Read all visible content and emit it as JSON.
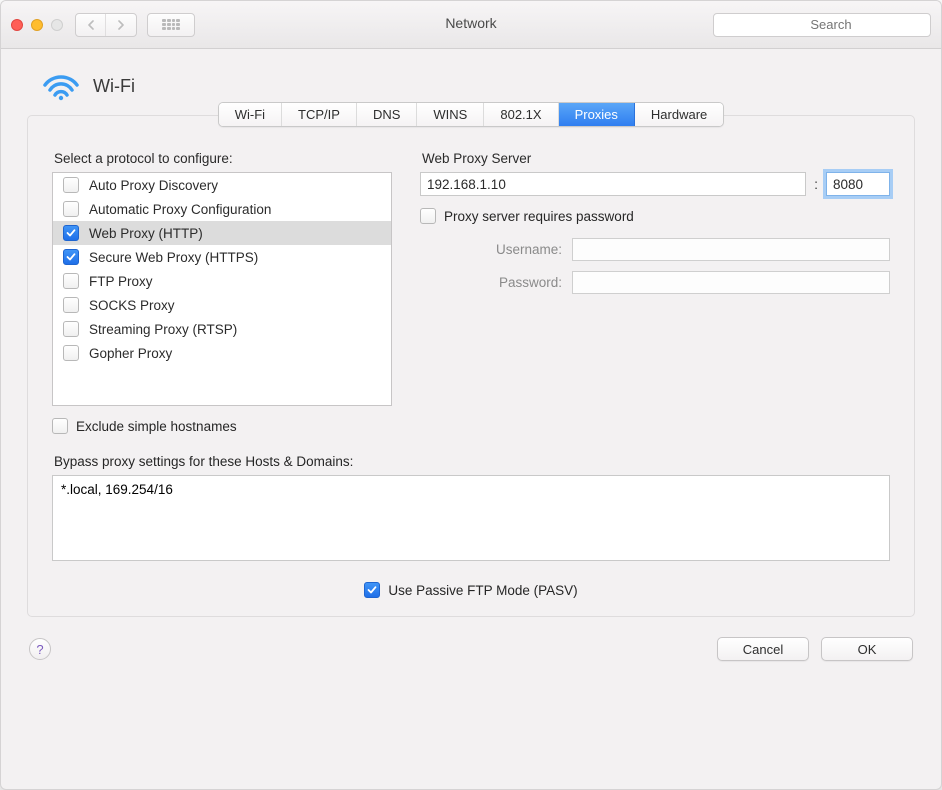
{
  "window": {
    "title": "Network",
    "search_placeholder": "Search"
  },
  "header": {
    "title": "Wi-Fi"
  },
  "tabs": [
    {
      "label": "Wi-Fi",
      "active": false
    },
    {
      "label": "TCP/IP",
      "active": false
    },
    {
      "label": "DNS",
      "active": false
    },
    {
      "label": "WINS",
      "active": false
    },
    {
      "label": "802.1X",
      "active": false
    },
    {
      "label": "Proxies",
      "active": true
    },
    {
      "label": "Hardware",
      "active": false
    }
  ],
  "protocols": {
    "section_label": "Select a protocol to configure:",
    "items": [
      {
        "label": "Auto Proxy Discovery",
        "checked": false,
        "selected": false
      },
      {
        "label": "Automatic Proxy Configuration",
        "checked": false,
        "selected": false
      },
      {
        "label": "Web Proxy (HTTP)",
        "checked": true,
        "selected": true
      },
      {
        "label": "Secure Web Proxy (HTTPS)",
        "checked": true,
        "selected": false
      },
      {
        "label": "FTP Proxy",
        "checked": false,
        "selected": false
      },
      {
        "label": "SOCKS Proxy",
        "checked": false,
        "selected": false
      },
      {
        "label": "Streaming Proxy (RTSP)",
        "checked": false,
        "selected": false
      },
      {
        "label": "Gopher Proxy",
        "checked": false,
        "selected": false
      }
    ],
    "exclude_simple_label": "Exclude simple hostnames",
    "exclude_simple_checked": false
  },
  "server": {
    "section_label": "Web Proxy Server",
    "host": "192.168.1.10",
    "port": "8080",
    "requires_password_label": "Proxy server requires password",
    "requires_password_checked": false,
    "username_label": "Username:",
    "username_value": "",
    "password_label": "Password:",
    "password_value": ""
  },
  "bypass": {
    "label": "Bypass proxy settings for these Hosts & Domains:",
    "value": "*.local, 169.254/16"
  },
  "pasv": {
    "label": "Use Passive FTP Mode (PASV)",
    "checked": true
  },
  "footer": {
    "cancel": "Cancel",
    "ok": "OK"
  }
}
